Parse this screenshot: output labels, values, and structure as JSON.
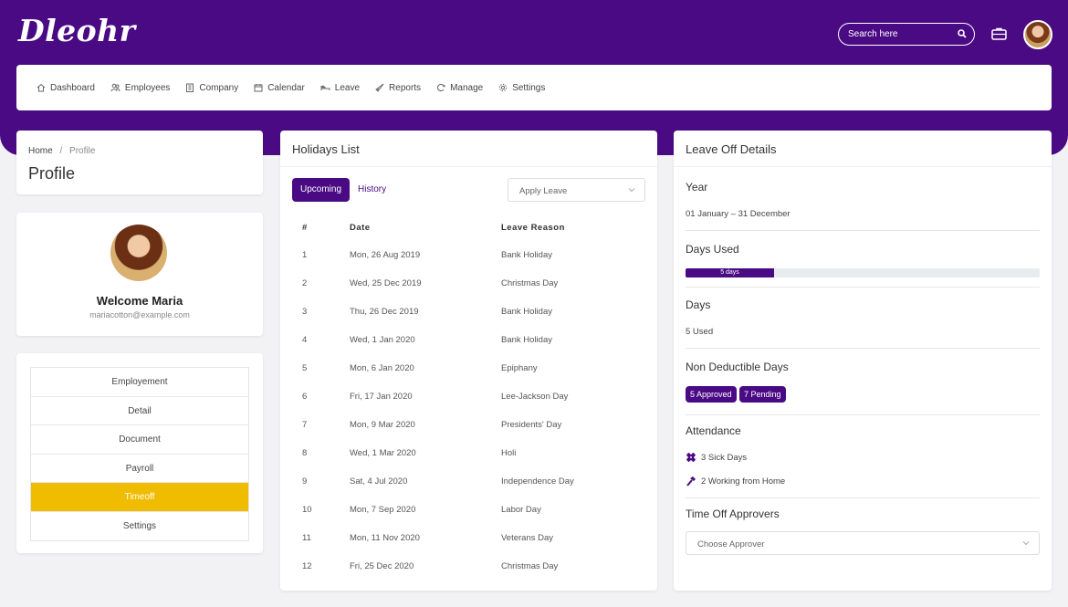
{
  "app": {
    "logo": "Dleohr"
  },
  "search": {
    "placeholder": "Search here"
  },
  "nav": {
    "items": [
      {
        "label": "Dashboard",
        "icon": "home-icon"
      },
      {
        "label": "Employees",
        "icon": "users-icon"
      },
      {
        "label": "Company",
        "icon": "building-icon"
      },
      {
        "label": "Calendar",
        "icon": "calendar-icon"
      },
      {
        "label": "Leave",
        "icon": "bed-icon"
      },
      {
        "label": "Reports",
        "icon": "rocket-icon"
      },
      {
        "label": "Manage",
        "icon": "refresh-icon"
      },
      {
        "label": "Settings",
        "icon": "gear-icon"
      }
    ]
  },
  "breadcrumb": {
    "home": "Home",
    "separator": "/",
    "current": "Profile"
  },
  "page": {
    "title": "Profile"
  },
  "profile": {
    "welcome": "Welcome Maria",
    "email": "mariacotton@example.com"
  },
  "profile_menu": {
    "items": [
      "Employement",
      "Detail",
      "Document",
      "Payroll",
      "Timeoff",
      "Settings"
    ],
    "active": "Timeoff"
  },
  "holidays": {
    "title": "Holidays List",
    "tabs": {
      "upcoming": "Upcoming",
      "history": "History"
    },
    "apply_leave": "Apply Leave",
    "columns": {
      "num": "#",
      "date": "Date",
      "reason": "Leave Reason"
    },
    "rows": [
      {
        "num": "1",
        "date": "Mon, 26 Aug 2019",
        "reason": "Bank Holiday"
      },
      {
        "num": "2",
        "date": "Wed, 25 Dec 2019",
        "reason": "Christmas Day"
      },
      {
        "num": "3",
        "date": "Thu, 26 Dec 2019",
        "reason": "Bank Holiday"
      },
      {
        "num": "4",
        "date": "Wed, 1 Jan 2020",
        "reason": "Bank Holiday"
      },
      {
        "num": "5",
        "date": "Mon, 6 Jan 2020",
        "reason": "Epiphany"
      },
      {
        "num": "6",
        "date": "Fri, 17 Jan 2020",
        "reason": "Lee-Jackson Day"
      },
      {
        "num": "7",
        "date": "Mon, 9 Mar 2020",
        "reason": "Presidents' Day"
      },
      {
        "num": "8",
        "date": "Wed, 1 Mar 2020",
        "reason": "Holi"
      },
      {
        "num": "9",
        "date": "Sat, 4 Jul 2020",
        "reason": "Independence Day"
      },
      {
        "num": "10",
        "date": "Mon, 7 Sep 2020",
        "reason": "Labor Day"
      },
      {
        "num": "11",
        "date": "Mon, 11 Nov 2020",
        "reason": "Veterans Day"
      },
      {
        "num": "12",
        "date": "Fri, 25 Dec 2020",
        "reason": "Christmas Day"
      }
    ]
  },
  "leave": {
    "title": "Leave Off Details",
    "year_label": "Year",
    "year_value": "01 January – 31 December",
    "days_used_label": "Days Used",
    "days_used_bar": "5 days",
    "days_used_fraction": 0.25,
    "days_label": "Days",
    "days_value": "5 Used",
    "non_deductible_label": "Non Deductible Days",
    "approved": "5 Approved",
    "pending": "7 Pending",
    "attendance_label": "Attendance",
    "sick_days": "3 Sick Days",
    "working_home": "2 Working from Home",
    "approvers_label": "Time Off Approvers",
    "approver_placeholder": "Choose Approver"
  },
  "colors": {
    "primary": "#4a0a84",
    "active_menu": "#f0bc00",
    "background": "#f2f2f5"
  }
}
